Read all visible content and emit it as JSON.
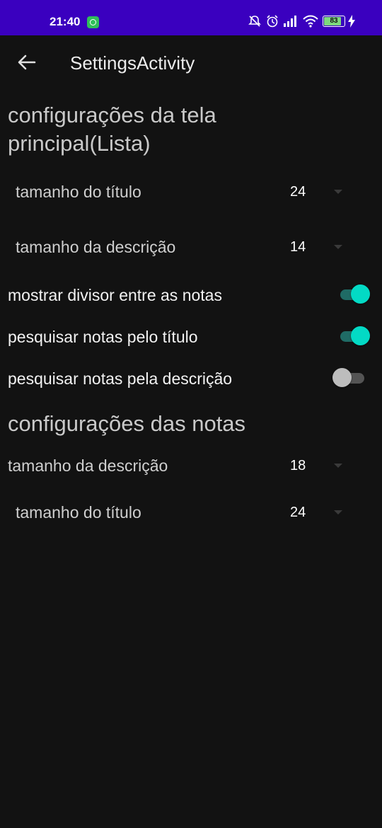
{
  "status_bar": {
    "time": "21:40",
    "battery": "83",
    "icons": [
      "whatsapp-icon",
      "mute-icon",
      "alarm-icon",
      "signal-icon",
      "wifi-icon",
      "battery-icon",
      "charging-icon"
    ]
  },
  "toolbar": {
    "title": "SettingsActivity"
  },
  "main_screen_settings": {
    "category_title": "configurações da tela principal(Lista)",
    "title_size": {
      "label": "tamanho do título",
      "value": "24"
    },
    "description_size": {
      "label": "tamanho da descrição",
      "value": "14"
    },
    "show_divider": {
      "label": "mostrar divisor entre as notas",
      "checked": true
    },
    "search_by_title": {
      "label": "pesquisar notas pelo título",
      "checked": true
    },
    "search_by_description": {
      "label": "pesquisar notas pela descrição",
      "checked": false
    }
  },
  "notes_settings": {
    "category_title": "configurações das notas",
    "description_size": {
      "label": "tamanho da descrição",
      "value": "18"
    },
    "title_size": {
      "label": "tamanho do título",
      "value": "24"
    }
  },
  "colors": {
    "status_bar": "#3a00bf",
    "background": "#121212",
    "switch_on": "#03dac5",
    "switch_off": "#bdbdbd"
  }
}
